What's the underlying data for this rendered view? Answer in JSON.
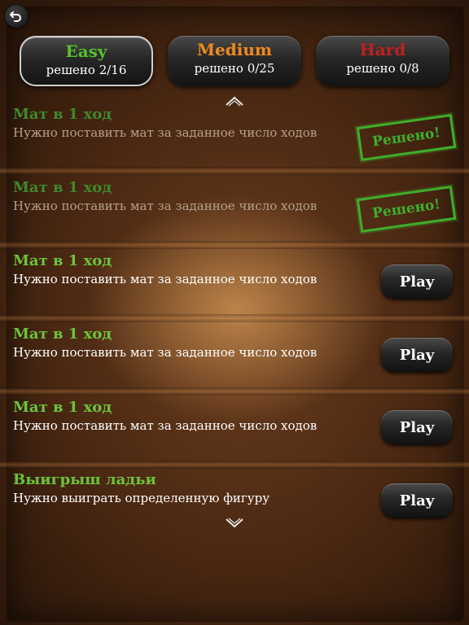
{
  "tabs": [
    {
      "name": "Easy",
      "count": "решено 2/16",
      "color": "#55c12c"
    },
    {
      "name": "Medium",
      "count": "решено 0/25",
      "color": "#f08a1d"
    },
    {
      "name": "Hard",
      "count": "решено 0/8",
      "color": "#c21f1f"
    }
  ],
  "puzzles": [
    {
      "title": "Мат в 1 ход",
      "description": "Нужно поставить мат за заданное число ходов",
      "status": "Решено!"
    },
    {
      "title": "Мат в 1 ход",
      "description": "Нужно поставить мат за заданное число ходов",
      "status": "Решено!"
    },
    {
      "title": "Мат в 1 ход",
      "description": "Нужно поставить мат за заданное число ходов",
      "action": "Play"
    },
    {
      "title": "Мат в 1 ход",
      "description": "Нужно поставить мат за заданное число ходов",
      "action": "Play"
    },
    {
      "title": "Мат в 1 ход",
      "description": "Нужно поставить мат за заданное число ходов",
      "action": "Play"
    },
    {
      "title": "Выигрыш ладьи",
      "description": "Нужно выиграть определенную фигуру",
      "action": "Play"
    }
  ],
  "icons": {
    "back": "back-arrow-icon",
    "scroll_up": "chevron-up-icon",
    "scroll_down": "chevron-down-icon"
  }
}
